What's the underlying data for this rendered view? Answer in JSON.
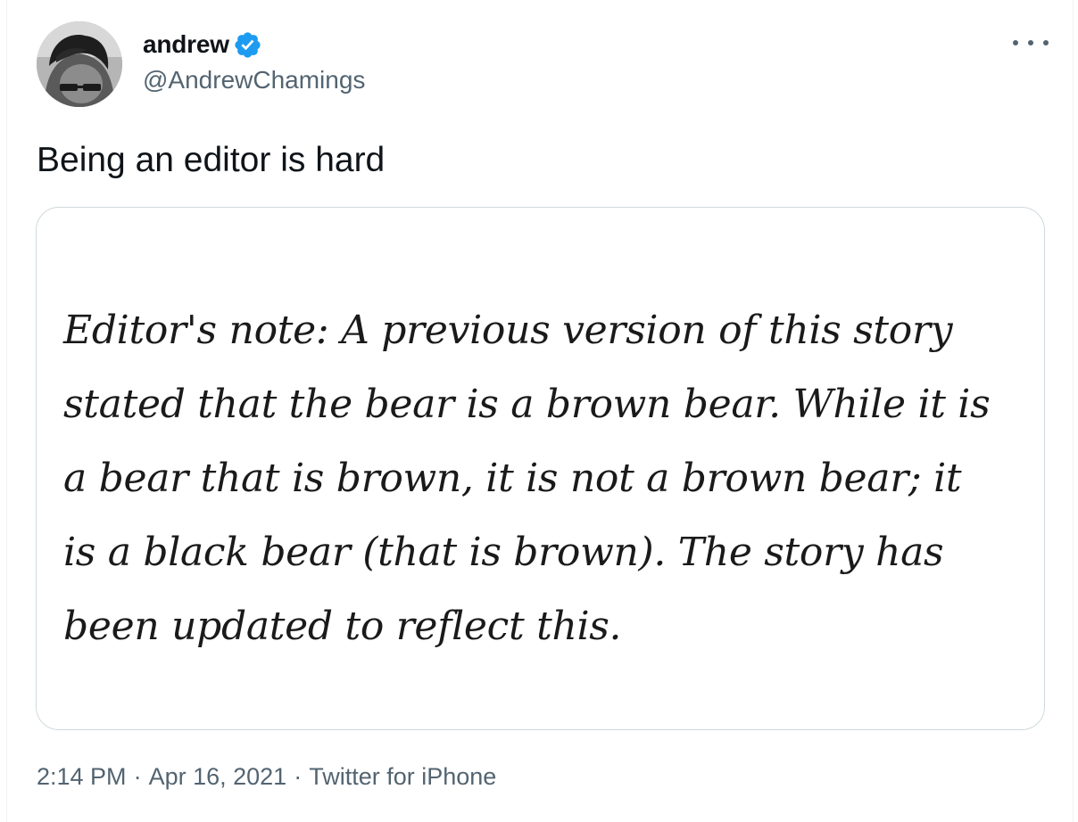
{
  "author": {
    "display_name": "andrew",
    "handle": "@AndrewChamings",
    "verified": true,
    "verified_color": "#1d9bf0"
  },
  "tweet": {
    "text": "Being an editor is hard",
    "media_text_lines": [
      "Editor's note: A previous version of this story",
      "stated that the bear is a brown bear. While it is",
      "a bear that is brown, it is not a brown bear; it",
      "is a black bear (that is brown). The story has",
      "been updated to reflect this."
    ]
  },
  "meta": {
    "time": "2:14 PM",
    "separator": "·",
    "date": "Apr 16, 2021",
    "source": "Twitter for iPhone"
  },
  "icons": {
    "more": "more-options-icon",
    "verified": "verified-badge-icon"
  }
}
